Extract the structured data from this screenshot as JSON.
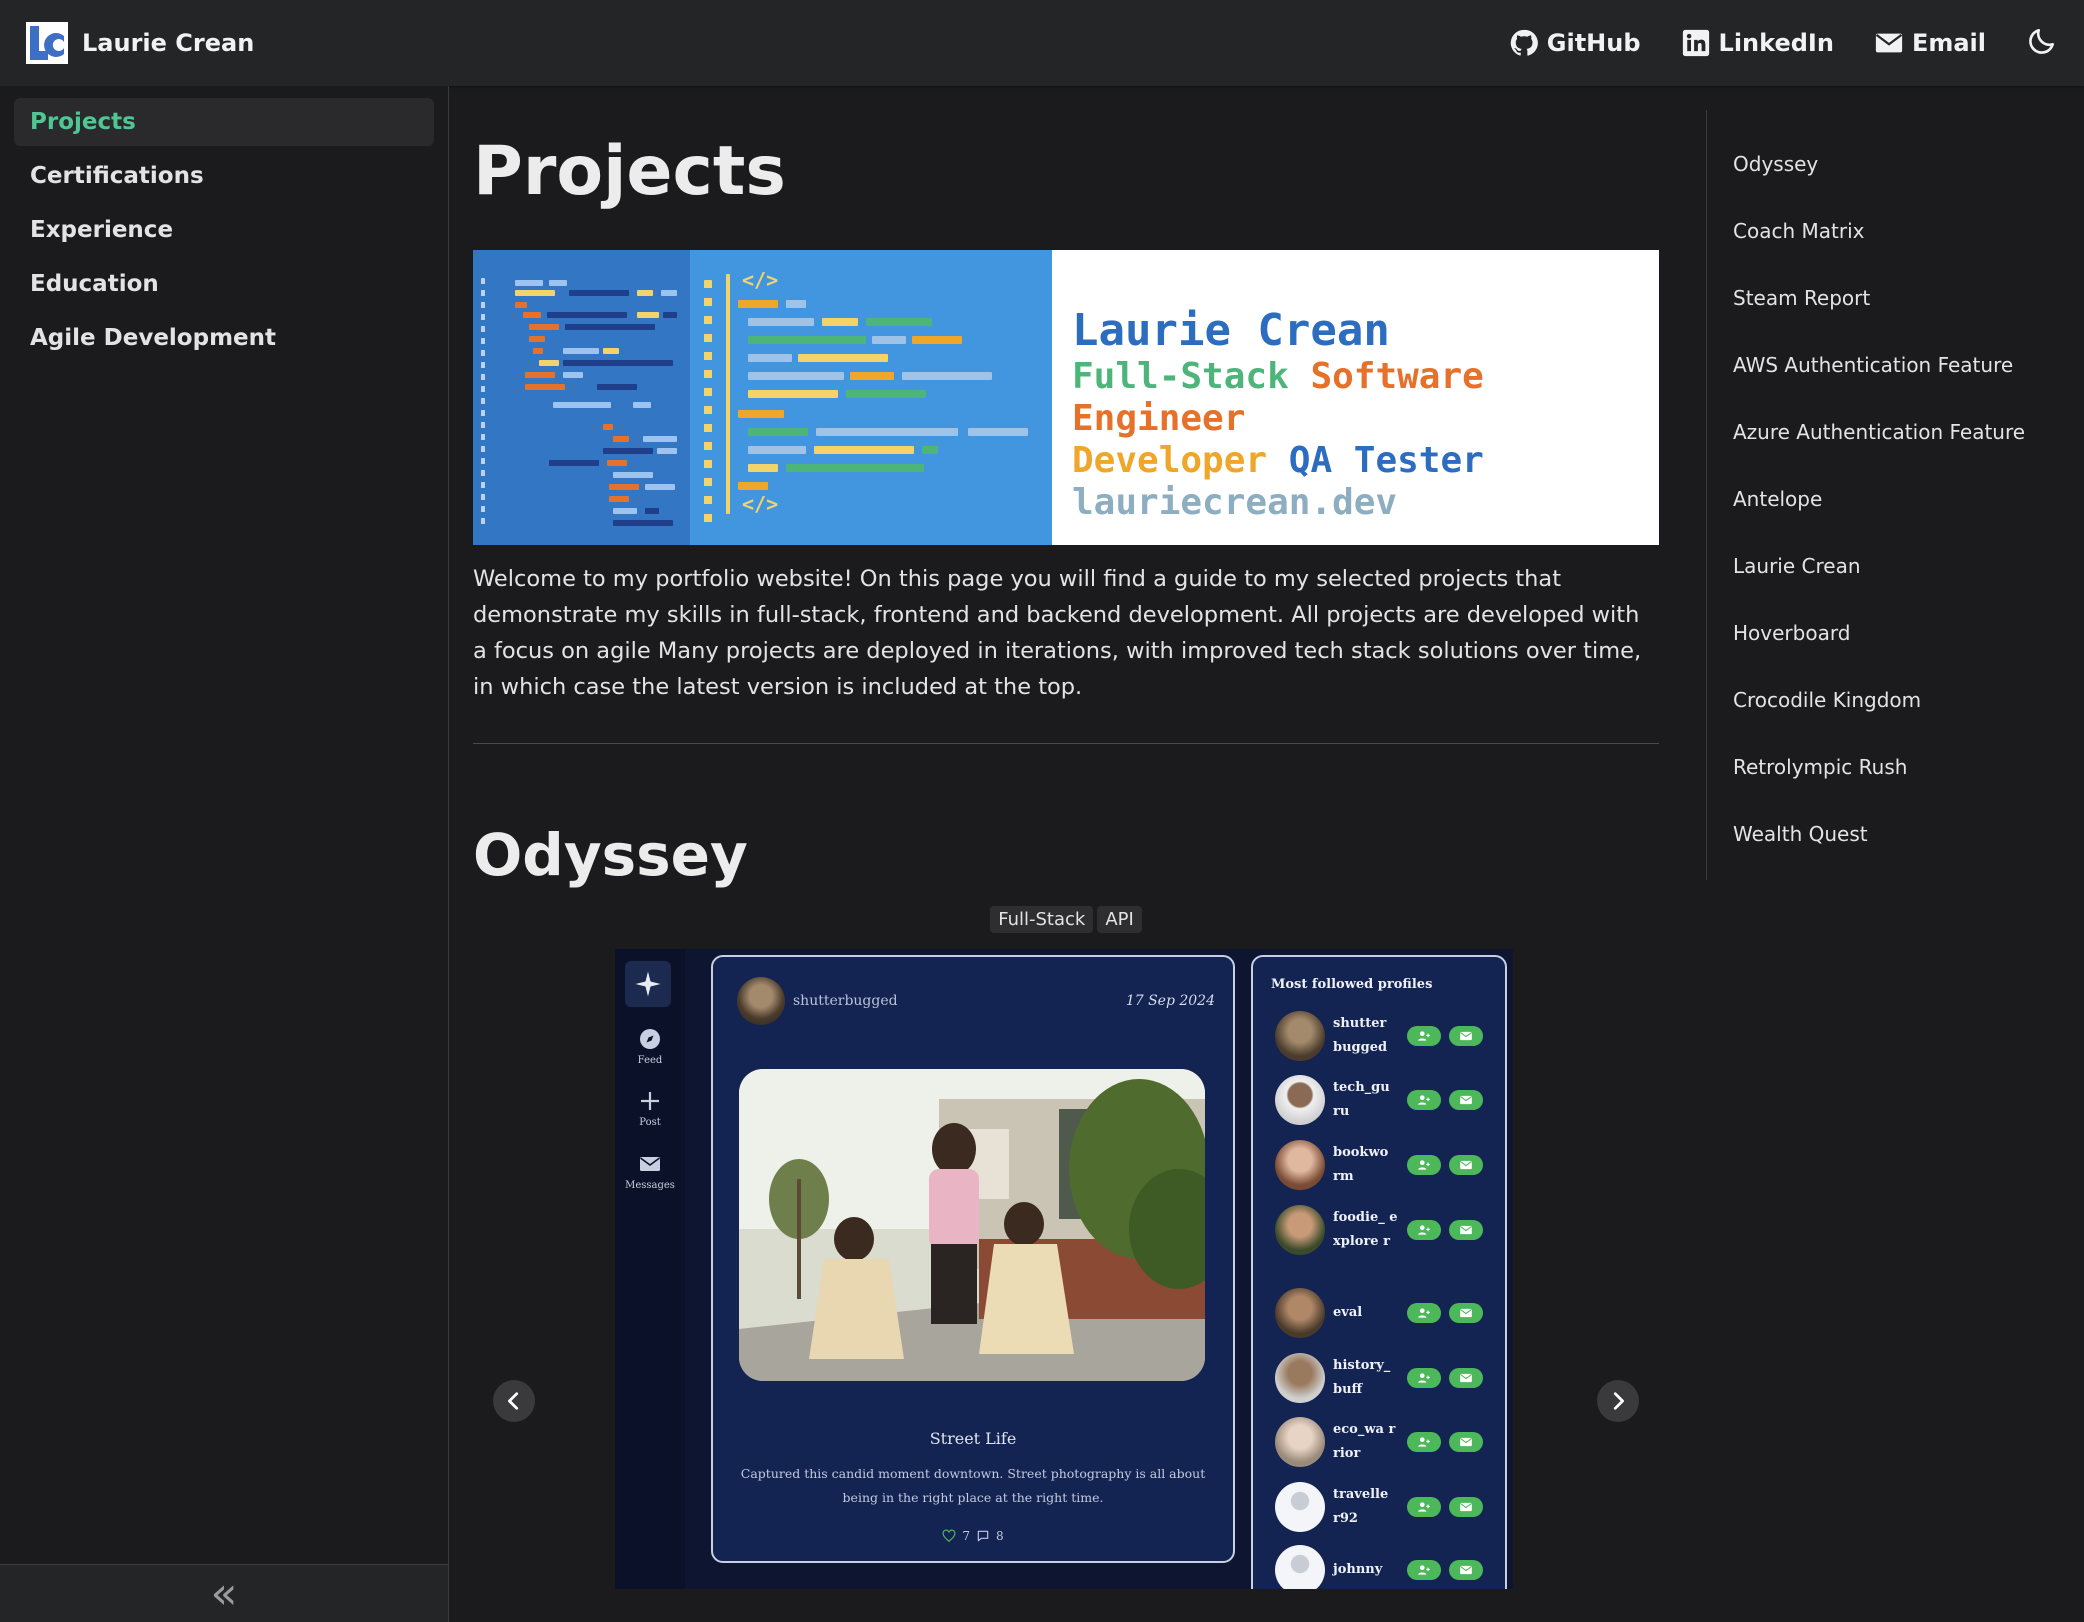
{
  "navbar": {
    "title": "Laurie Crean",
    "links": [
      {
        "label": "GitHub",
        "icon": "github-icon"
      },
      {
        "label": "LinkedIn",
        "icon": "linkedin-icon"
      },
      {
        "label": "Email",
        "icon": "envelope-icon"
      }
    ],
    "theme_icon": "moon-icon"
  },
  "sidebar": {
    "items": [
      {
        "label": "Projects",
        "active": true
      },
      {
        "label": "Certifications"
      },
      {
        "label": "Experience"
      },
      {
        "label": "Education"
      },
      {
        "label": "Agile Development"
      }
    ],
    "collapse_label": "«"
  },
  "main": {
    "title": "Projects",
    "banner": {
      "name": "Laurie Crean",
      "line1_a": "Full-Stack",
      "line1_b": "Software Engineer",
      "line2_a": "Developer",
      "line2_b": "QA Tester",
      "domain": "lauriecrean.dev",
      "code_top": "</>",
      "code_bottom": "</>"
    },
    "intro": "Welcome to my portfolio website! On this page you will find a guide to my selected projects that demonstrate my skills in full-stack, frontend and backend development. All projects are developed with a focus on agile Many projects are deployed in iterations, with improved tech stack solutions over time, in which case the latest version is included at the top.",
    "section_title": "Odyssey",
    "tags": [
      "Full-Stack",
      "API"
    ]
  },
  "screenshot": {
    "rail": [
      {
        "label": "Feed",
        "icon": "compass-icon"
      },
      {
        "label": "Post",
        "icon": "plus-icon"
      },
      {
        "label": "Messages",
        "icon": "envelope-icon"
      }
    ],
    "post": {
      "author": "shutterbugged",
      "date": "17 Sep 2024",
      "title": "Street Life",
      "text": "Captured this candid moment downtown. Street photography is all about being in the right place at the right time.",
      "likes": "7",
      "comments": "8"
    },
    "profiles_title": "Most followed profiles",
    "profiles": [
      {
        "name": "shutter bugged"
      },
      {
        "name": "tech_gu ru"
      },
      {
        "name": "bookwo rm"
      },
      {
        "name": "foodie_ explore r"
      },
      {
        "name": "eval"
      },
      {
        "name": "history_ buff"
      },
      {
        "name": "eco_wa rrior"
      },
      {
        "name": "travelle r92"
      },
      {
        "name": "johnny"
      }
    ]
  },
  "toc": {
    "items": [
      "Odyssey",
      "Coach Matrix",
      "Steam Report",
      "AWS Authentication Feature",
      "Azure Authentication Feature",
      "Antelope",
      "Laurie Crean",
      "Hoverboard",
      "Crocodile Kingdom",
      "Retrolympic Rush",
      "Wealth Quest"
    ]
  },
  "colors": {
    "accent": "#4fc795",
    "background": "#1b1b1d",
    "navbar": "#242526",
    "banner_blue": "#2c6dc0",
    "banner_orange": "#e5712a",
    "banner_green": "#4db57a",
    "banner_yellow": "#eea72a"
  }
}
